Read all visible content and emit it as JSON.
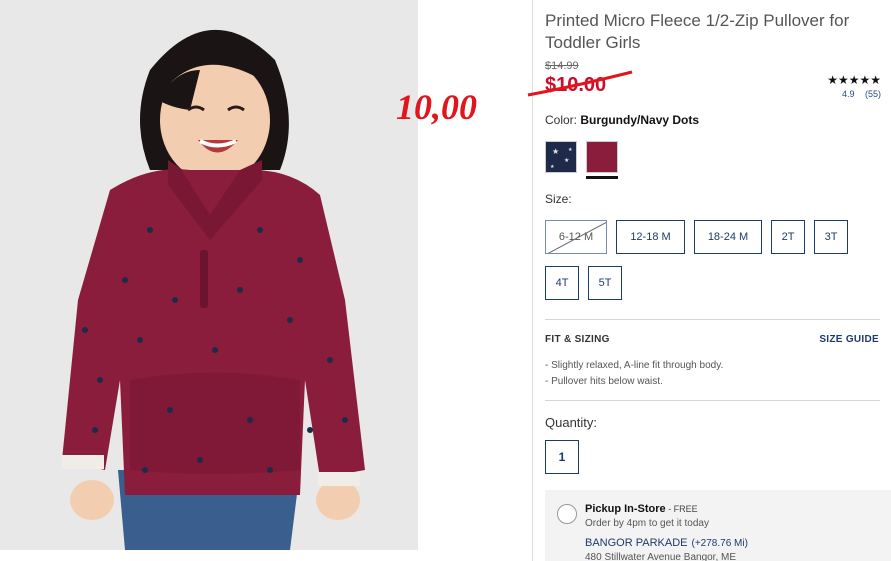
{
  "product": {
    "title": "Printed Micro Fleece 1/2-Zip Pullover for Toddler Girls",
    "old_price": "$14.99",
    "sale_price": "$10.00",
    "annotation_price": "10,00",
    "rating": {
      "stars": "★★★★★",
      "score": "4.9",
      "count": "(55)"
    }
  },
  "color": {
    "label": "Color:",
    "selected": "Burgundy/Navy Dots",
    "swatches": [
      {
        "name": "navy-stars",
        "color": "#1f2a4a"
      },
      {
        "name": "burgundy-dots",
        "color": "#8b1d3c"
      }
    ]
  },
  "size": {
    "label": "Size:",
    "options": [
      "6-12 M",
      "12-18 M",
      "18-24 M",
      "2T",
      "3T",
      "4T",
      "5T"
    ],
    "unavailable": [
      "6-12 M"
    ]
  },
  "fit": {
    "title": "FIT & SIZING",
    "size_guide": "SIZE GUIDE",
    "items": [
      "-  Slightly relaxed, A-line fit through body.",
      "-  Pullover hits below waist."
    ]
  },
  "quantity": {
    "label": "Quantity:",
    "value": "1"
  },
  "pickup": {
    "title": "Pickup In-Store",
    "free": " - FREE",
    "subtitle": "Order by 4pm to get it today",
    "store_name": "BANGOR PARKADE",
    "store_distance": "(+278.76 Mi)",
    "store_address": "480 Stillwater Avenue Bangor, ME"
  },
  "colors": {
    "accent": "#1d3b6a",
    "sale": "#c8102e",
    "annotation": "#e2141c",
    "garment": "#8b1d3c"
  }
}
